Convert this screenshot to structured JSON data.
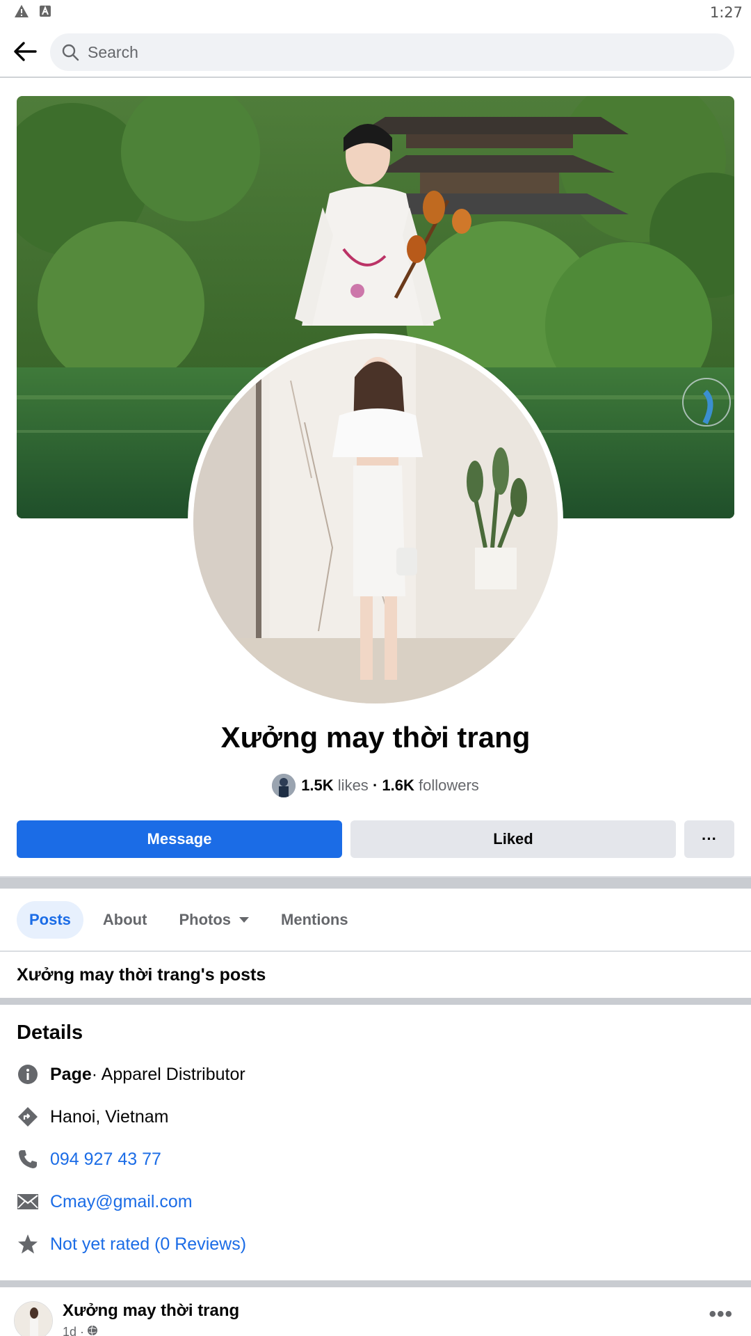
{
  "status_bar": {
    "time": "1:27"
  },
  "search": {
    "placeholder": "Search"
  },
  "page": {
    "name": "Xưởng may thời trang",
    "likes_count": "1.5K",
    "likes_label": "likes",
    "separator": "·",
    "followers_count": "1.6K",
    "followers_label": "followers"
  },
  "actions": {
    "message": "Message",
    "liked": "Liked",
    "more": "···"
  },
  "tabs": [
    {
      "label": "Posts",
      "active": true
    },
    {
      "label": "About"
    },
    {
      "label": "Photos"
    },
    {
      "label": "Mentions"
    }
  ],
  "posts_heading": "Xưởng may thời trang's posts",
  "details": {
    "title": "Details",
    "category_prefix": "Page",
    "category": " · Apparel Distributor",
    "location": "Hanoi, Vietnam",
    "phone": "094 927 43 77",
    "email": "Cmay@gmail.com",
    "rating": "Not yet rated (0 Reviews)"
  },
  "post": {
    "author": "Xưởng may thời trang",
    "time": "1d ·",
    "more": "•••"
  },
  "icons": {
    "back": "arrow-left-icon",
    "search": "search-icon",
    "info": "info-icon",
    "directions": "directions-icon",
    "phone": "phone-icon",
    "email": "envelope-icon",
    "rating": "star-icon",
    "globe": "globe-icon"
  },
  "colors": {
    "accent": "#1b6ce6",
    "secondary_button": "#e4e6eb",
    "muted_text": "#65676b"
  }
}
